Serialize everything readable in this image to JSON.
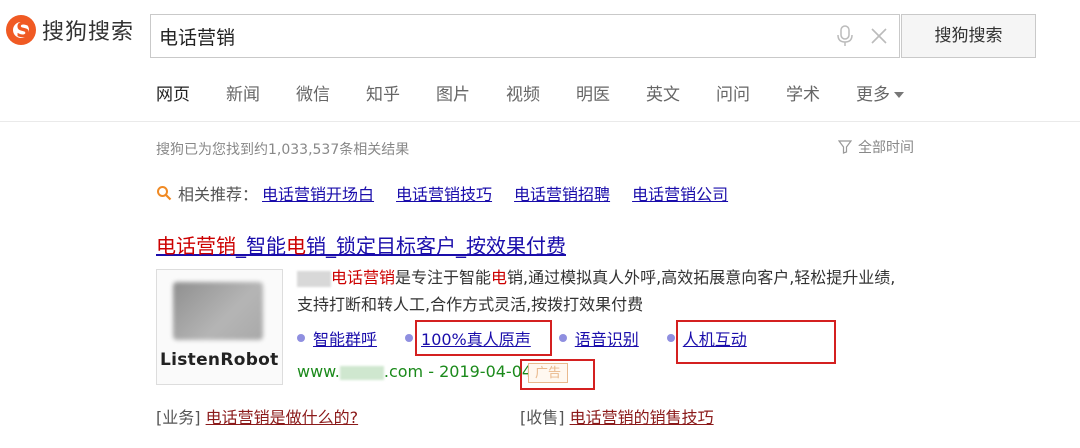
{
  "header": {
    "logo_text": "搜狗搜索",
    "logo_glyph": "S",
    "search_value": "电话营销",
    "search_button": "搜狗搜索",
    "icons": [
      "microphone-icon",
      "clear-icon"
    ]
  },
  "tabs": [
    {
      "label": "网页",
      "active": true
    },
    {
      "label": "新闻"
    },
    {
      "label": "微信"
    },
    {
      "label": "知乎"
    },
    {
      "label": "图片"
    },
    {
      "label": "视频"
    },
    {
      "label": "明医"
    },
    {
      "label": "英文"
    },
    {
      "label": "问问"
    },
    {
      "label": "学术"
    },
    {
      "label": "更多"
    }
  ],
  "results_meta": {
    "count_text": "搜狗已为您找到约1,033,537条相关结果",
    "time_filter": "全部时间"
  },
  "related": {
    "label": "相关推荐：",
    "items": [
      "电话营销开场白",
      "电话营销技巧",
      "电话营销招聘",
      "电话营销公司"
    ]
  },
  "ad": {
    "title_parts": [
      "电话营销",
      "_智能",
      "电",
      "销_锁定目标客户_按效果付费"
    ],
    "desc_hl1": "电话营销",
    "desc_p1": "是专注于智能",
    "desc_hl2": "电",
    "desc_p2": "销,通过模拟真人外呼,高效拓展意向客户,轻松提升业绩,支持打断和转人工,合作方式灵活,按拨打效果付费",
    "thumb_brand": "ListenRobot",
    "sitelinks": [
      "智能群呼",
      "100%真人原声",
      "语音识别",
      "人机互动"
    ],
    "url_prefix": "www.",
    "url_suffix": ".com - 2019-04-04",
    "ad_tag": "广告"
  },
  "bottom_links": [
    {
      "prefix": "[业务]",
      "link": "电话营销是做什么的?"
    },
    {
      "prefix": "[收售]",
      "link": "电话营销的销售技巧"
    }
  ],
  "colors": {
    "brand_orange": "#f05a23",
    "link_blue": "#1a0dab",
    "highlight_red": "#cc0000",
    "url_green": "#1b8a1b",
    "annotation_red": "#d42020"
  }
}
